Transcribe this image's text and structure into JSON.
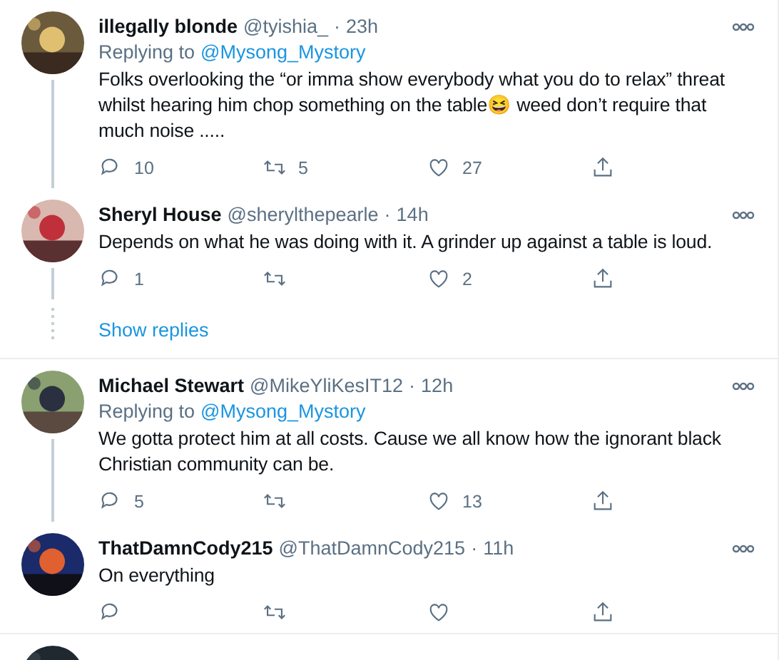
{
  "tweets": [
    {
      "name": "illegally blonde",
      "handle": "@tyishia_",
      "separator": "·",
      "time": "23h",
      "replying_label": "Replying to",
      "replying_to": "@Mysong_Mystory",
      "text": "Folks overlooking the “or imma show everybody what you do to relax” threat whilst hearing him chop something on the table😆 weed don’t require that much noise .....",
      "replies": "10",
      "retweets": "5",
      "likes": "27",
      "thread_below": true
    },
    {
      "name": "Sheryl House",
      "handle": "@sherylthepearle",
      "separator": "·",
      "time": "14h",
      "text": "Depends on what he was doing with it. A grinder up against a table is loud.",
      "replies": "1",
      "likes": "2",
      "thread_below": false,
      "show_replies": "Show replies"
    },
    {
      "name": "Michael Stewart",
      "handle": "@MikeYliKesIT12",
      "separator": "·",
      "time": "12h",
      "replying_label": "Replying to",
      "replying_to": "@Mysong_Mystory",
      "text": "We gotta protect him at all costs. Cause we all know how the ignorant black Christian community can be.",
      "replies": "5",
      "likes": "13",
      "thread_below": true
    },
    {
      "name": "ThatDamnCody215",
      "handle": "@ThatDamnCody215",
      "separator": "·",
      "time": "11h",
      "text": "On everything",
      "thread_below": false
    },
    {
      "thread_below": false
    }
  ]
}
